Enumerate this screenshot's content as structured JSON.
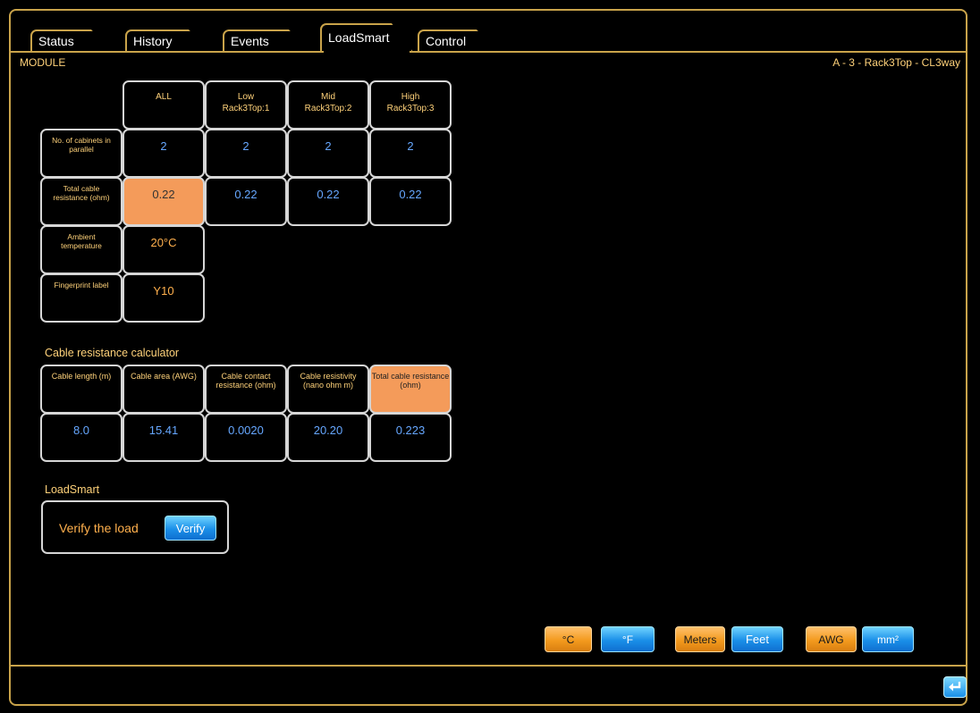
{
  "tabs": [
    {
      "label": "Status"
    },
    {
      "label": "History"
    },
    {
      "label": "Events"
    },
    {
      "label": "LoadSmart",
      "active": true
    },
    {
      "label": "Control"
    }
  ],
  "module_label": "MODULE",
  "device_label": "A - 3 - Rack3Top - CL3way",
  "load_table": {
    "columns": [
      "ALL",
      "Low\nRack3Top:1",
      "Mid\nRack3Top:2",
      "High\nRack3Top:3"
    ],
    "rows": [
      {
        "label": "No. of cabinets in parallel",
        "values": [
          "2",
          "2",
          "2",
          "2"
        ]
      },
      {
        "label": "Total cable resistance (ohm)",
        "values": [
          "0.22",
          "0.22",
          "0.22",
          "0.22"
        ]
      },
      {
        "label": "Ambient temperature",
        "values": [
          "20°C"
        ]
      },
      {
        "label": "Fingerprint label",
        "values": [
          "Y10"
        ]
      }
    ]
  },
  "calculator": {
    "title": "Cable resistance calculator",
    "headers": [
      "Cable length (m)",
      "Cable area (AWG)",
      "Cable contact resistance (ohm)",
      "Cable resistivity (nano ohm m)",
      "Total cable resistance (ohm)"
    ],
    "values": [
      "8.0",
      "15.41",
      "0.0020",
      "20.20",
      "0.223"
    ]
  },
  "loadsmart": {
    "title": "LoadSmart",
    "text": "Verify the load",
    "button": "Verify"
  },
  "units": {
    "celsius": "°C",
    "fahrenheit": "°F",
    "meters": "Meters",
    "feet": "Feet",
    "awg": "AWG",
    "mm2": "mm²"
  },
  "icons": {
    "return": "return-icon"
  },
  "colors": {
    "accent": "#c9a34a",
    "highlight": "#f49b5a",
    "value_blue": "#66a7ff",
    "value_orange": "#ffb04d"
  }
}
